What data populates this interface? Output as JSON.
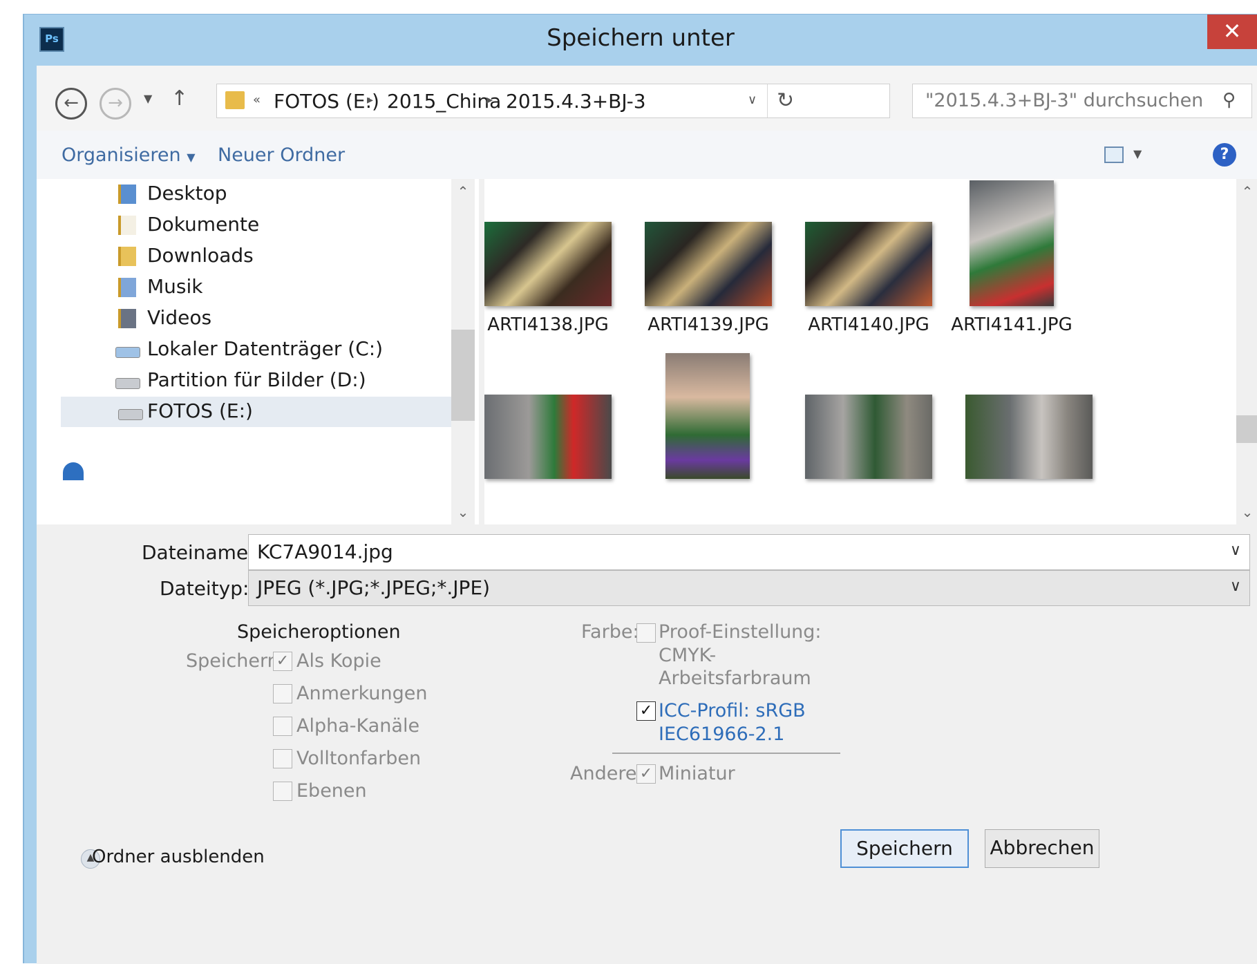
{
  "window": {
    "title": "Speichern unter",
    "app_icon_text": "Ps"
  },
  "nav": {
    "path": [
      "FOTOS (E:)",
      "2015_China",
      "2015.4.3+BJ-3"
    ],
    "search_placeholder": "\"2015.4.3+BJ-3\" durchsuchen"
  },
  "toolbar": {
    "organize_label": "Organisieren",
    "new_folder_label": "Neuer Ordner"
  },
  "sidebar": {
    "items": [
      {
        "label": "Desktop",
        "icon": "desktop-folder-icon"
      },
      {
        "label": "Dokumente",
        "icon": "documents-folder-icon"
      },
      {
        "label": "Downloads",
        "icon": "downloads-folder-icon"
      },
      {
        "label": "Musik",
        "icon": "music-folder-icon"
      },
      {
        "label": "Videos",
        "icon": "videos-folder-icon"
      },
      {
        "label": "Lokaler Datenträger (C:)",
        "icon": "system-drive-icon"
      },
      {
        "label": "Partition für Bilder (D:)",
        "icon": "drive-icon"
      },
      {
        "label": "FOTOS (E:)",
        "icon": "drive-icon",
        "selected": true
      }
    ]
  },
  "files": [
    {
      "name": "ARTI4138.JPG"
    },
    {
      "name": "ARTI4139.JPG"
    },
    {
      "name": "ARTI4140.JPG"
    },
    {
      "name": "ARTI4141.JPG"
    },
    {
      "name": ""
    },
    {
      "name": ""
    },
    {
      "name": ""
    },
    {
      "name": ""
    }
  ],
  "form": {
    "filename_label": "Dateiname:",
    "filename_value": "KC7A9014.jpg",
    "filetype_label": "Dateityp:",
    "filetype_value": "JPEG (*.JPG;*.JPEG;*.JPE)"
  },
  "options": {
    "title": "Speicheroptionen",
    "save_label": "Speichern:",
    "save_items": [
      {
        "label": "Als Kopie",
        "checked": true
      },
      {
        "label": "Anmerkungen",
        "checked": false
      },
      {
        "label": "Alpha-Kanäle",
        "checked": false
      },
      {
        "label": "Volltonfarben",
        "checked": false
      },
      {
        "label": "Ebenen",
        "checked": false
      }
    ],
    "color_label": "Farbe:",
    "proof_line1": "Proof-Einstellung:",
    "proof_line2": "CMYK-",
    "proof_line3": "Arbeitsfarbraum",
    "icc_line1": "ICC-Profil: sRGB",
    "icc_line2": "IEC61966-2.1",
    "icc_checked": true,
    "other_label": "Andere:",
    "thumbnail_label": "Miniatur",
    "thumbnail_checked": true
  },
  "footer": {
    "hide_folders_label": "Ordner ausblenden",
    "save_button": "Speichern",
    "cancel_button": "Abbrechen"
  },
  "colors": {
    "titlebar": "#a9d0ec",
    "close": "#c7423b",
    "link": "#3f6ba2",
    "accent": "#2e6db9"
  }
}
